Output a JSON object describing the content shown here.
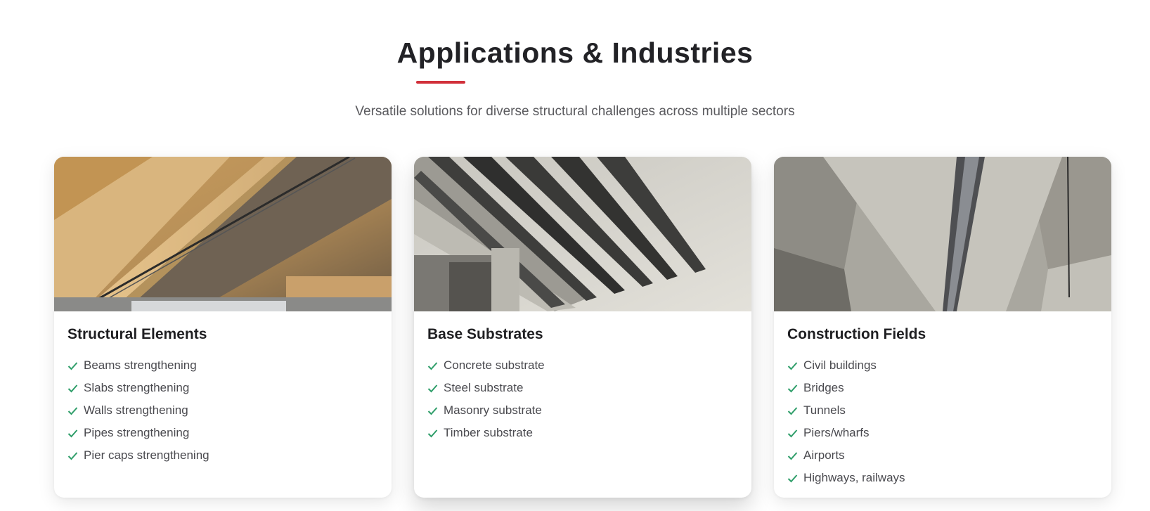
{
  "header": {
    "title": "Applications & Industries",
    "subtitle": "Versatile solutions for diverse structural challenges across multiple sectors",
    "accent_color": "#d1303a"
  },
  "check_icon": {
    "name": "check-icon",
    "color": "#2f9e6a"
  },
  "cards": [
    {
      "title": "Structural Elements",
      "image": "wooden-beam-strengthening-photo",
      "items": [
        "Beams strengthening",
        "Slabs strengthening",
        "Walls strengthening",
        "Pipes strengthening",
        "Pier caps strengthening"
      ]
    },
    {
      "title": "Base Substrates",
      "image": "concrete-ceiling-carbon-strips-photo",
      "items": [
        "Concrete substrate",
        "Steel substrate",
        "Masonry substrate",
        "Timber substrate"
      ]
    },
    {
      "title": "Construction Fields",
      "image": "bridge-underside-photo",
      "items": [
        "Civil buildings",
        "Bridges",
        "Tunnels",
        "Piers/wharfs",
        "Airports",
        "Highways, railways"
      ]
    }
  ]
}
